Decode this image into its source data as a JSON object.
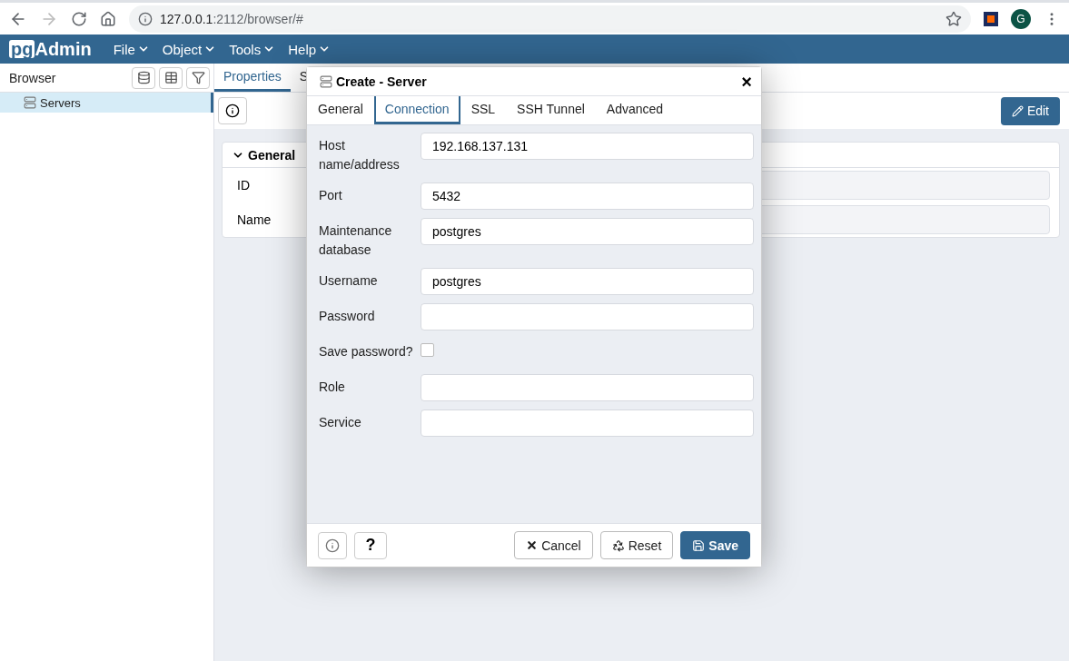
{
  "browser": {
    "url_host": "127.0.0.1",
    "url_path": ":2112/browser/#",
    "profile_initial": "G"
  },
  "app": {
    "logo_pg": "pg",
    "logo_admin": "Admin",
    "menus": [
      "File",
      "Object",
      "Tools",
      "Help"
    ]
  },
  "browser_panel": {
    "title": "Browser",
    "tree": [
      {
        "label": "Servers",
        "selected": true
      }
    ]
  },
  "main_tabs": [
    {
      "label": "Properties",
      "selected": true
    },
    {
      "label": "S",
      "selected": false
    }
  ],
  "edit_button": "Edit",
  "properties": {
    "section": "General",
    "expanded": true,
    "fields": [
      "ID",
      "Name"
    ]
  },
  "dialog": {
    "title": "Create - Server",
    "close": "×",
    "tabs": [
      {
        "label": "General",
        "selected": false
      },
      {
        "label": "Connection",
        "selected": true
      },
      {
        "label": "SSL",
        "selected": false
      },
      {
        "label": "SSH Tunnel",
        "selected": false
      },
      {
        "label": "Advanced",
        "selected": false
      }
    ],
    "fields": [
      {
        "kind": "text",
        "label": "Host name/address",
        "value": "192.168.137.131"
      },
      {
        "kind": "text",
        "label": "Port",
        "value": "5432"
      },
      {
        "kind": "text",
        "label": "Maintenance database",
        "value": "postgres"
      },
      {
        "kind": "text",
        "label": "Username",
        "value": "postgres"
      },
      {
        "kind": "text",
        "label": "Password"
      },
      {
        "kind": "checkbox",
        "label": "Save password?",
        "checked": false
      },
      {
        "kind": "text",
        "label": "Role"
      },
      {
        "kind": "text",
        "label": "Service"
      }
    ],
    "help": "?",
    "buttons": [
      {
        "kind": "cancel",
        "label": "Cancel"
      },
      {
        "kind": "reset",
        "label": "Reset"
      },
      {
        "kind": "save",
        "label": "Save"
      }
    ]
  }
}
